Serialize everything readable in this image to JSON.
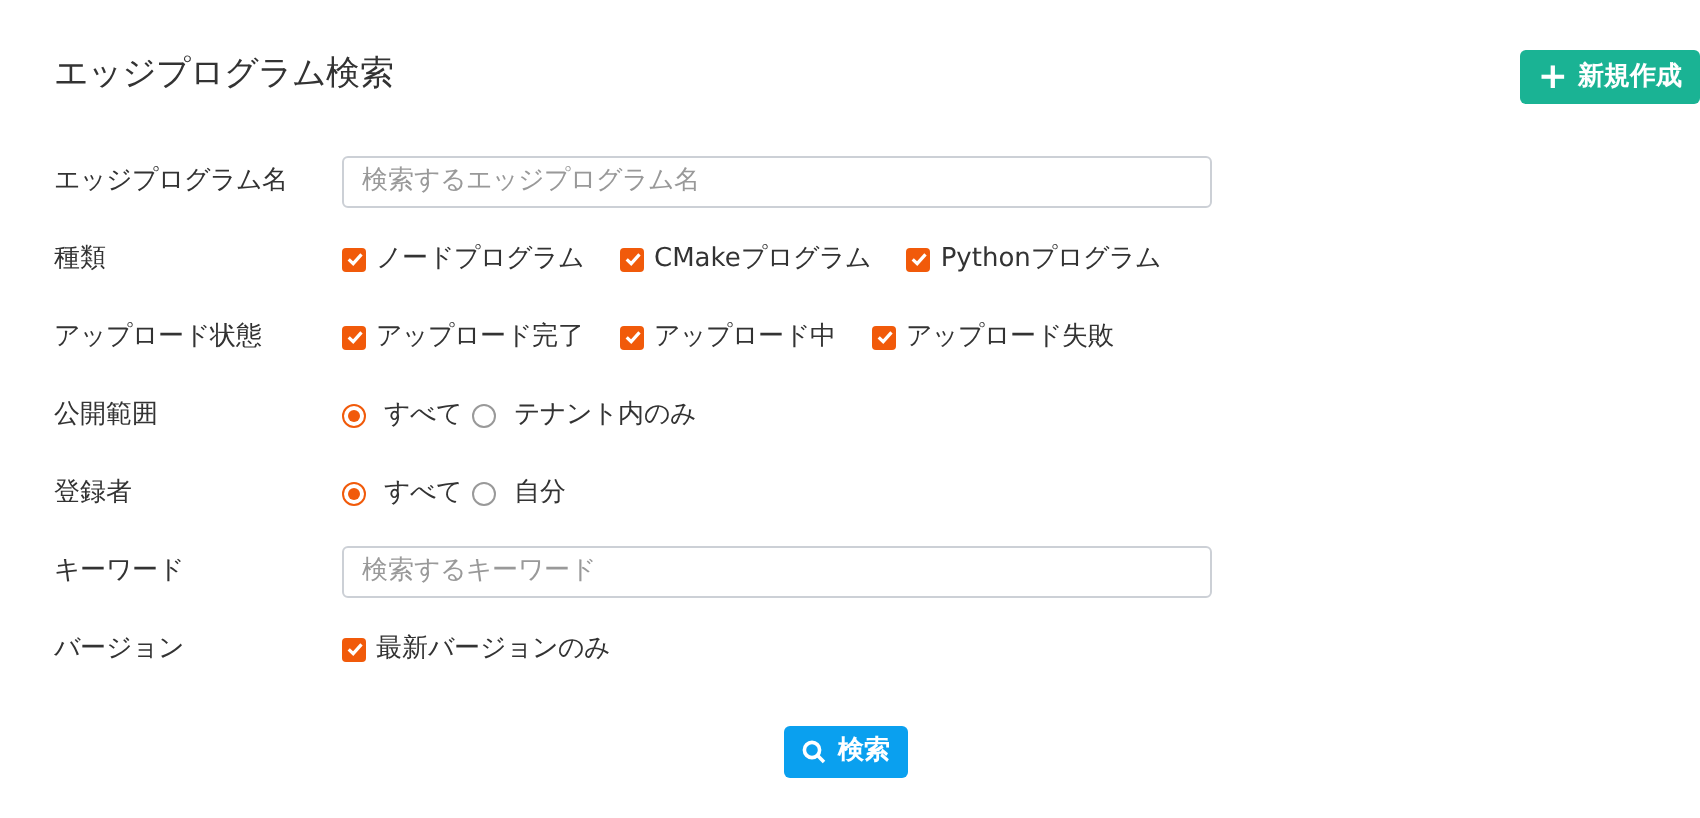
{
  "title": "エッジプログラム検索",
  "new_button": {
    "icon": "+",
    "label": "新規作成"
  },
  "fields": [
    {
      "kind": "input",
      "label": "エッジプログラム名",
      "placeholder": "検索するエッジプログラム名"
    },
    {
      "kind": "checkboxes",
      "label": "種類",
      "options": [
        {
          "label": "ノードプログラム",
          "checked": true
        },
        {
          "label": "CMakeプログラム",
          "checked": true
        },
        {
          "label": "Pythonプログラム",
          "checked": true
        }
      ]
    },
    {
      "kind": "checkboxes",
      "label": "アップロード状態",
      "options": [
        {
          "label": "アップロード完了",
          "checked": true
        },
        {
          "label": "アップロード中",
          "checked": true
        },
        {
          "label": "アップロード失敗",
          "checked": true
        }
      ]
    },
    {
      "kind": "radios",
      "label": "公開範囲",
      "options": [
        {
          "label": "すべて",
          "selected": true
        },
        {
          "label": "テナント内のみ",
          "selected": false
        }
      ]
    },
    {
      "kind": "radios",
      "label": "登録者",
      "options": [
        {
          "label": "すべて",
          "selected": true
        },
        {
          "label": "自分",
          "selected": false
        }
      ]
    },
    {
      "kind": "input",
      "label": "キーワード",
      "placeholder": "検索するキーワード"
    },
    {
      "kind": "checkboxes",
      "label": "バージョン",
      "options": [
        {
          "label": "最新バージョンのみ",
          "checked": true
        }
      ]
    }
  ],
  "search_button": {
    "label": "検索"
  }
}
